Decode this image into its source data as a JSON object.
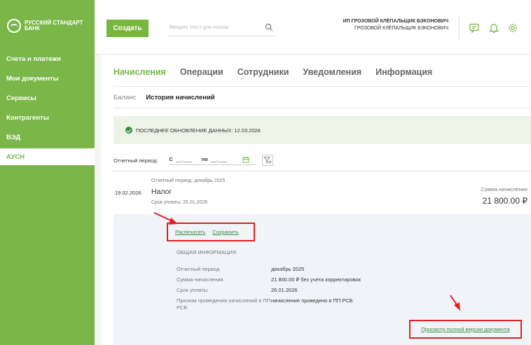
{
  "brand": {
    "line1": "Русский Стандарт",
    "line2": "Банк"
  },
  "sidebar": {
    "items": [
      {
        "label": "Счета и платежи"
      },
      {
        "label": "Мои документы"
      },
      {
        "label": "Сервисы"
      },
      {
        "label": "Контрагенты"
      },
      {
        "label": "ВЭД"
      },
      {
        "label": "АУСН"
      }
    ],
    "active_index": 5
  },
  "header": {
    "create_label": "Создать",
    "search_placeholder": "Введите текст для поиска",
    "user_line1": "ИП ГРОЗОВОЙ КЛЁПАЛЬЩИК БЭКОНОВИЧ",
    "user_line2": "ГРОЗОВОЙ КЛЁПАЛЬЩИК БЭКОНОВИЧ"
  },
  "tabs": [
    {
      "label": "Начисления"
    },
    {
      "label": "Операции"
    },
    {
      "label": "Сотрудники"
    },
    {
      "label": "Уведомления"
    },
    {
      "label": "Информация"
    }
  ],
  "subtabs": [
    {
      "label": "Баланс"
    },
    {
      "label": "История начислений"
    }
  ],
  "update": {
    "text": "ПОСЛЕДНЕЕ ОБНОВЛЕНИЕ ДАННЫХ: 12.03.2026"
  },
  "period_filter": {
    "label": "Отчетный период:",
    "from_label": "С",
    "from_value": "__.___",
    "to_label": "по",
    "to_value": "__.___"
  },
  "accrual": {
    "date": "19.02.2026",
    "period": "Отчетный период: декабрь 2025",
    "title": "Налог",
    "due": "Срок уплаты: 26.01.2026",
    "sum_label": "Сумма начисления",
    "sum": "21 800.00 ₽"
  },
  "details": {
    "print_label": "Распечатать",
    "save_label": "Сохранить",
    "section_title": "ОБЩАЯ ИНФОРМАЦИЯ",
    "rows": [
      {
        "label": "Отчетный период",
        "value": "декабрь 2025"
      },
      {
        "label": "Сумма начисления",
        "value": "21 800.00 ₽ без учета корректировок"
      },
      {
        "label": "Срок уплаты",
        "value": "26.01.2026"
      },
      {
        "label": "Признак проведения начислений в ПП РСБ",
        "value": "начисление проведено в ПП РСБ"
      }
    ],
    "full_view_label": "Просмотр полной версии документа"
  },
  "colors": {
    "brand_green": "#7ab648",
    "link_green": "#3c8c40",
    "highlight_red": "#e02020"
  }
}
